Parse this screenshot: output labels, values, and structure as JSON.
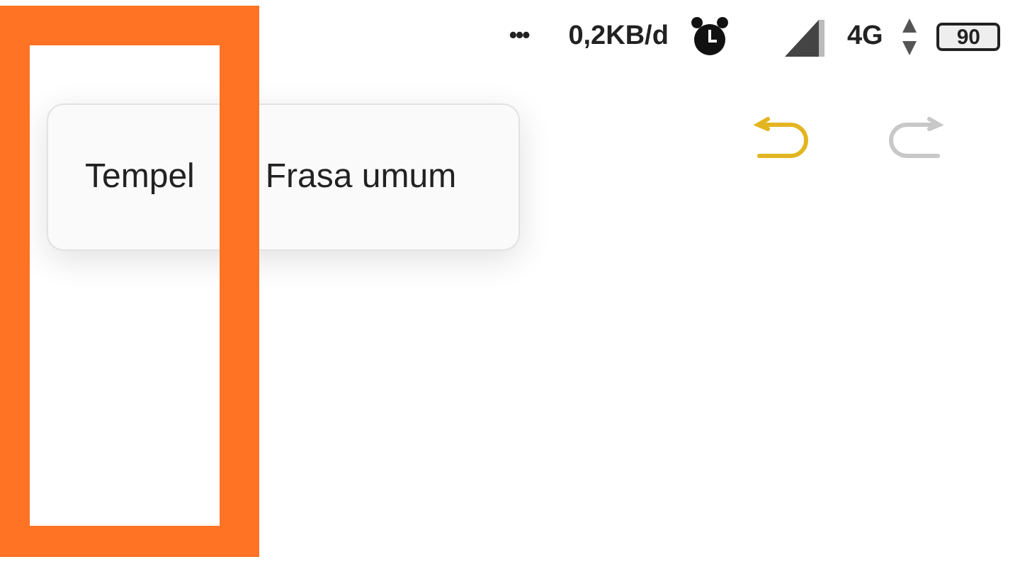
{
  "status_bar": {
    "more": "•••",
    "speed": "0,2KB/d",
    "network": "4G",
    "battery": "90"
  },
  "toolbar": {
    "undo": {
      "disabled": false
    },
    "redo": {
      "disabled": true
    }
  },
  "popup_menu": {
    "items": [
      "Tempel",
      "Frasa umum"
    ]
  }
}
